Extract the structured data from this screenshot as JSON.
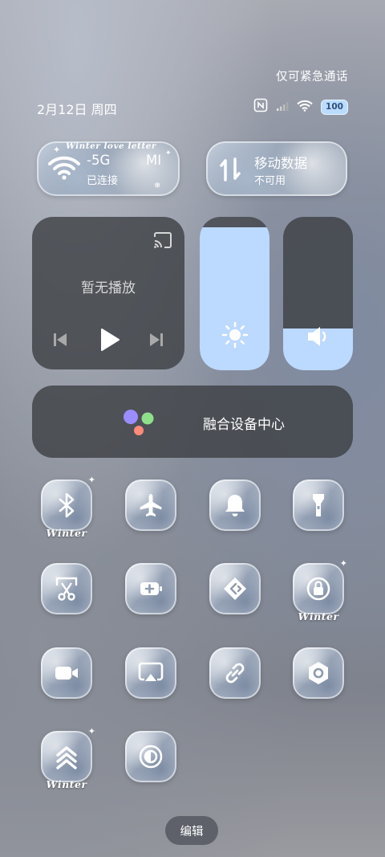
{
  "status_bar": {
    "emergency_text": "仅可紧急通话",
    "date_text": "2月12日 周四",
    "battery_level": "100",
    "battery_color": "#b9dcff"
  },
  "wifi_toggle": {
    "decor_text": "Winter love letter",
    "ssid": "-5G",
    "ssid_suffix": "MI",
    "status": "已连接",
    "icon": "wifi-icon"
  },
  "mobile_data_toggle": {
    "title": "移动数据",
    "status": "不可用",
    "icon": "mobile-data-arrows-icon"
  },
  "media": {
    "status": "暂无播放",
    "icons": [
      "cast-icon",
      "previous-icon",
      "play-icon",
      "next-icon"
    ]
  },
  "brightness": {
    "level": 0.93,
    "icon": "sun-icon",
    "fill_color": "#bcd9ff"
  },
  "volume": {
    "level": 0.27,
    "icon": "speaker-icon",
    "fill_color": "#bcd9ff"
  },
  "device_hub": {
    "label": "融合设备中心",
    "icon": "device-hub-dots-icon"
  },
  "quick_tiles": [
    {
      "icon": "bluetooth-icon",
      "winter_label": "Winter"
    },
    {
      "icon": "airplane-icon"
    },
    {
      "icon": "bell-icon"
    },
    {
      "icon": "flashlight-icon"
    },
    {
      "icon": "screenshot-scissors-icon"
    },
    {
      "icon": "battery-saver-icon"
    },
    {
      "icon": "nearby-share-icon"
    },
    {
      "icon": "rotation-lock-icon",
      "winter_label": "Winter"
    },
    {
      "icon": "video-camera-icon"
    },
    {
      "icon": "screen-cast-icon"
    },
    {
      "icon": "link-icon"
    },
    {
      "icon": "settings-hexagon-icon"
    },
    {
      "icon": "chevrons-up-icon",
      "winter_label": "Winter"
    },
    {
      "icon": "dark-mode-icon"
    }
  ],
  "edit_button": {
    "label": "编辑"
  }
}
